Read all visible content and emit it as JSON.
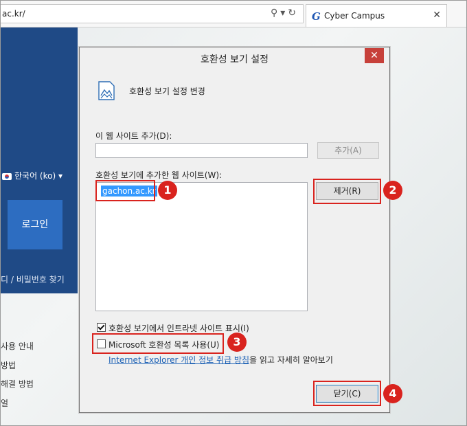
{
  "browser": {
    "address_text": "ac.kr/",
    "address_icons": "⚲▾↻",
    "tab_logo": "G",
    "tab_title": "Cyber Campus",
    "tab_close": "✕"
  },
  "background_page": {
    "language": "한국어 (ko) ▾",
    "login_button": "로그인",
    "find_link": "디 / 비밀번호 찾기",
    "menu_items": [
      "사용 안내",
      "방법",
      "해결 방법",
      "얼"
    ]
  },
  "dialog": {
    "title": "호환성 보기 설정",
    "close": "✕",
    "header_text": "호환성 보기 설정 변경",
    "add_site_label": "이 웹 사이트 추가(D):",
    "add_input_value": "",
    "add_button": "추가(A)",
    "list_label": "호환성 보기에 추가한 웹 사이트(W):",
    "list_items": [
      "gachon.ac.kr"
    ],
    "remove_button": "제거(R)",
    "intranet_checkbox_label": "호환성 보기에서 인트라넷 사이트 표시(I)",
    "intranet_checked": true,
    "ms_list_checkbox_label": "Microsoft 호환성 목록 사용(U)",
    "ms_list_checked": false,
    "privacy_link": "Internet Explorer 개인 정보 취급 방침",
    "privacy_suffix": "을 읽고 자세히 알아보기",
    "close_button": "닫기(C)"
  },
  "callouts": [
    "1",
    "2",
    "3",
    "4"
  ],
  "colors": {
    "callout_red": "#d9231e",
    "selection_blue": "#3399ff",
    "panel_blue": "#1f4a86"
  }
}
